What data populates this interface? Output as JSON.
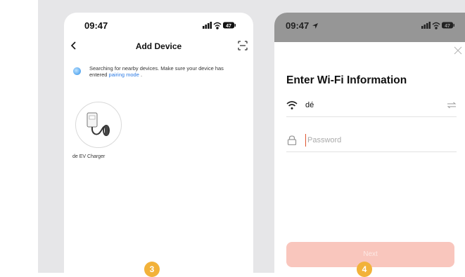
{
  "screen1": {
    "status_time": "09:47",
    "battery": "47",
    "title": "Add Device",
    "search_text": "Searching for nearby devices. Make sure your device has entered",
    "pairing_link": "pairing mode",
    "search_tail": " .",
    "device_name": "de EV Charger",
    "step": "3"
  },
  "screen2": {
    "status_time": "09:47",
    "battery": "47",
    "title": "Enter Wi-Fi Information",
    "ssid": "dé",
    "password_placeholder": "Password",
    "next_label": "Next",
    "step": "4"
  },
  "colors": {
    "panel_bg": "#e6e6e8",
    "accent_link": "#2c7be5",
    "next_button_bg": "#f9c6bd",
    "step_badge": "#f2b23a",
    "status_bar_gray": "#969696"
  },
  "icons": [
    "back-icon",
    "scan-icon",
    "wifi-icon",
    "lock-icon",
    "swap-icon",
    "close-icon",
    "signal-icon",
    "battery-icon",
    "location-arrow-icon"
  ]
}
